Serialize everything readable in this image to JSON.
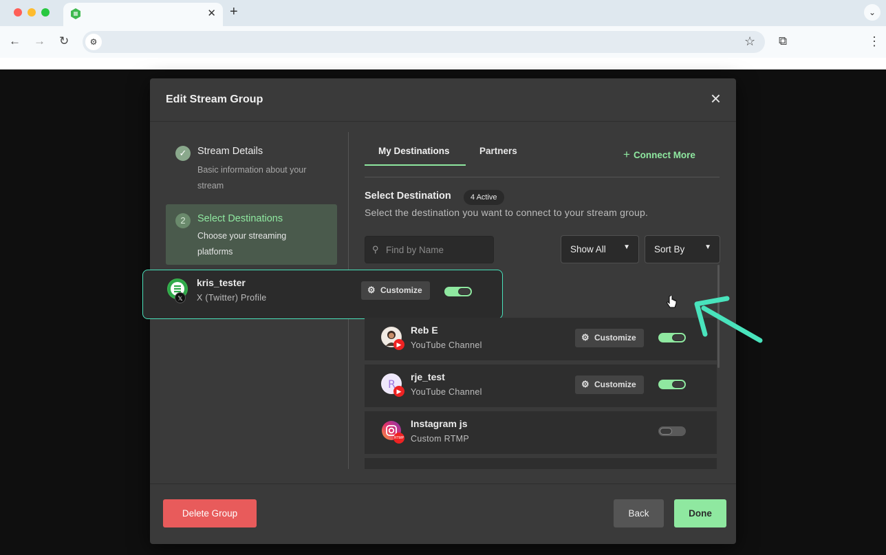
{
  "browser": {
    "new_tab": "+",
    "close_tab": "✕",
    "url": ""
  },
  "modal": {
    "title": "Edit Stream Group",
    "steps": [
      {
        "number": "✓",
        "title": "Stream Details",
        "desc": "Basic information about your stream",
        "state": "done"
      },
      {
        "number": "2",
        "title": "Select Destinations",
        "desc": "Choose your streaming platforms",
        "state": "active"
      }
    ],
    "tabs": [
      {
        "label": "My Destinations",
        "active": true
      },
      {
        "label": "Partners",
        "active": false
      }
    ],
    "connect_more": "Connect More",
    "select_title": "Select Destination",
    "active_badge": "4 Active",
    "select_desc": "Select the destination you want to connect to your stream group.",
    "search_placeholder": "Find by Name",
    "show_all": "Show All",
    "sort_by": "Sort By",
    "destinations": [
      {
        "name": "kris_tester",
        "type": "X (Twitter) Profile",
        "customize": "Customize",
        "enabled": true,
        "platform_icon": "x-icon"
      },
      {
        "name": "Reb E",
        "type": "YouTube Channel",
        "customize": "Customize",
        "enabled": true,
        "platform_icon": "youtube-icon"
      },
      {
        "name": "rje_test",
        "type": "YouTube Channel",
        "customize": "Customize",
        "enabled": true,
        "platform_icon": "youtube-icon"
      },
      {
        "name": "Instagram js",
        "type": "Custom RTMP",
        "customize": "",
        "enabled": false,
        "platform_icon": "rtmp-icon"
      }
    ],
    "buttons": {
      "delete": "Delete Group",
      "back": "Back",
      "done": "Done"
    }
  },
  "colors": {
    "accent": "#8fe8a0",
    "highlight": "#49e3bc",
    "danger": "#e85b5b"
  }
}
